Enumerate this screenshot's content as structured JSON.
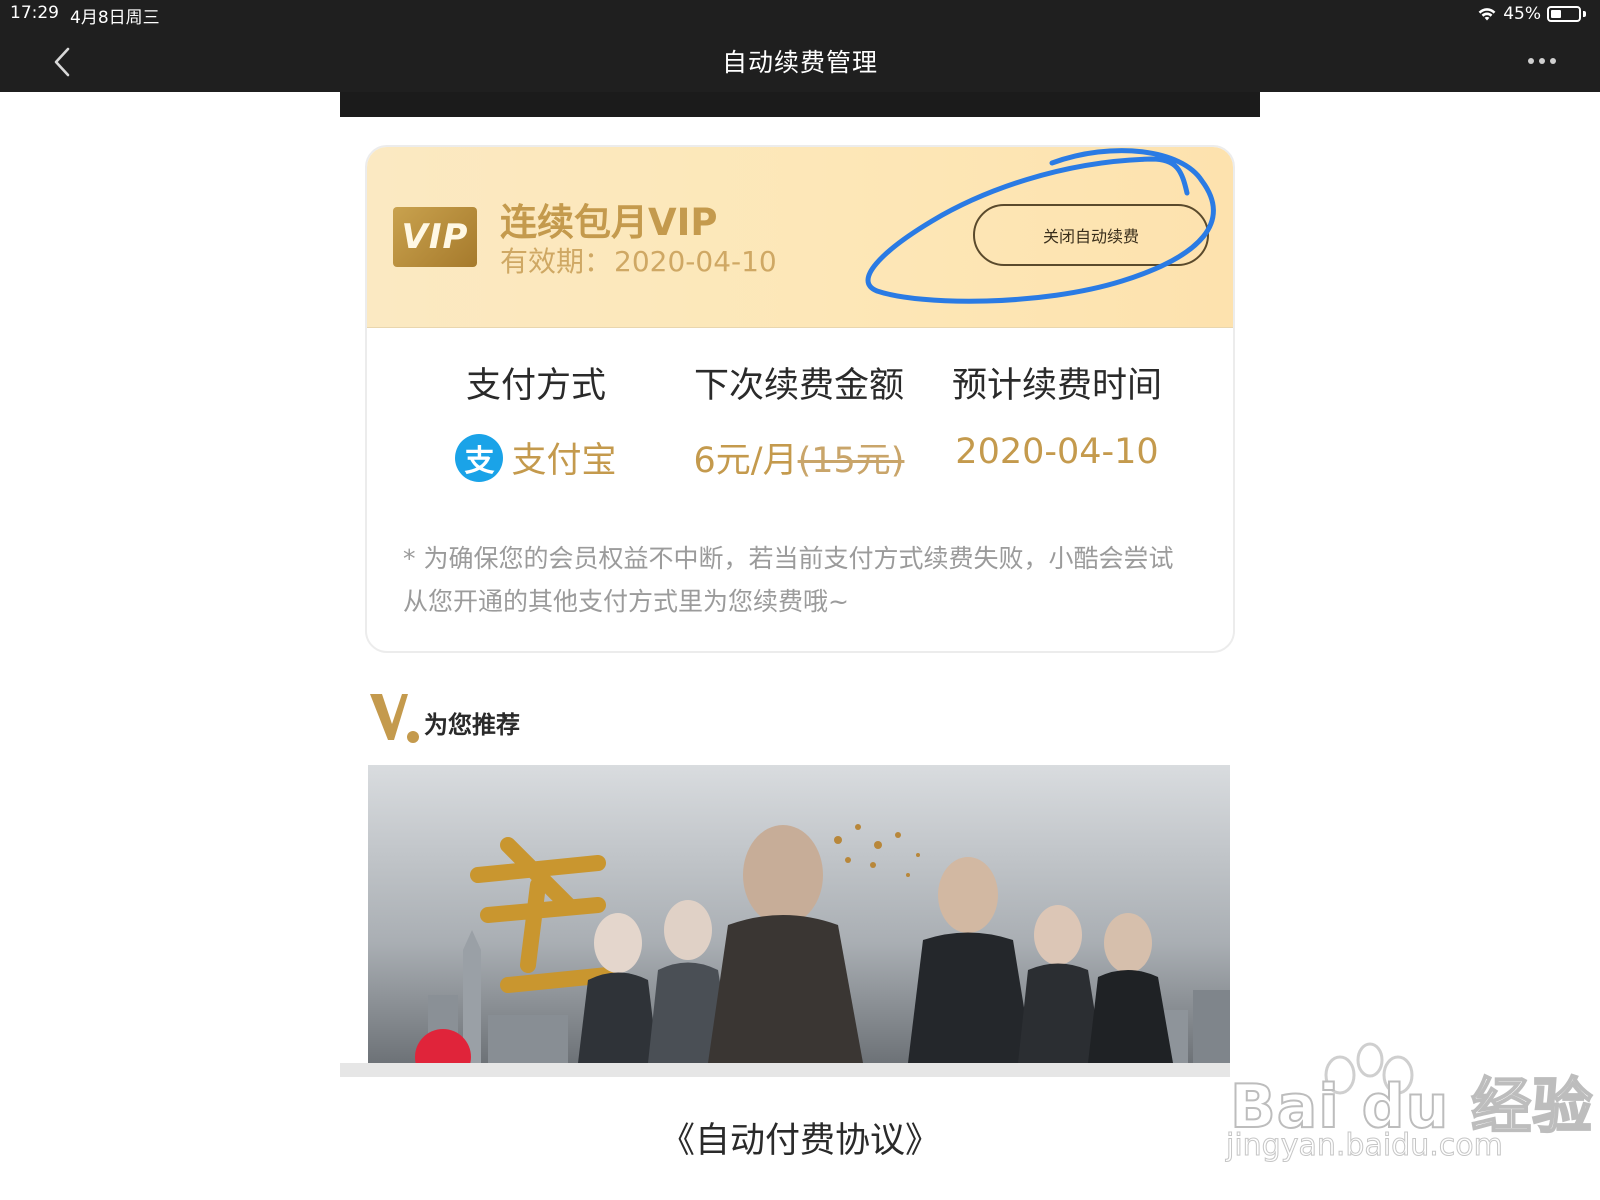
{
  "status_bar": {
    "time": "17:29",
    "date": "4月8日周三",
    "battery": "45%"
  },
  "nav": {
    "title": "自动续费管理",
    "back_icon": "chevron-left-icon",
    "more_icon": "more-dots-icon"
  },
  "vip_card": {
    "badge": "VIP",
    "plan_name": "连续包月VIP",
    "valid_label": "有效期：",
    "valid_date": "2020-04-10",
    "close_button": "关闭自动续费",
    "columns": [
      {
        "label": "支付方式",
        "value": "支付宝"
      },
      {
        "label": "下次续费金额",
        "value": "6元/月",
        "original_price": "(15元)"
      },
      {
        "label": "预计续费时间",
        "value": "2020-04-10"
      }
    ],
    "note": "* 为确保您的会员权益不中断，若当前支付方式续费失败，小酷会尝试从您开通的其他支付方式里为您续费哦~",
    "colors": {
      "gold": "#c49a4d",
      "header_bg": "#fde7b7",
      "alipay": "#1aa3e8",
      "annotation": "#2a7be4"
    }
  },
  "recommend": {
    "title": "为您推荐",
    "logo_icon": "v-logo-icon"
  },
  "agreement": {
    "label": "《自动付费协议》"
  },
  "watermark": {
    "brand": "Bai du 经验",
    "url": "jingyan.baidu.com"
  }
}
